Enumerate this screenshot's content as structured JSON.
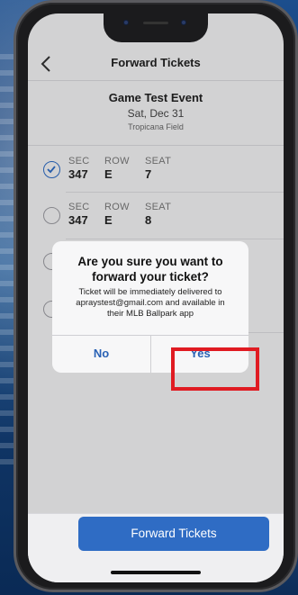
{
  "header": {
    "back_icon": "chevron-left-icon",
    "title": "Forward Tickets"
  },
  "event": {
    "name": "Game Test Event",
    "date": "Sat, Dec 31",
    "venue": "Tropicana Field"
  },
  "labels": {
    "sec": "SEC",
    "row": "ROW",
    "seat": "SEAT"
  },
  "tickets": [
    {
      "sec": "347",
      "row": "E",
      "seat": "7",
      "selected": true
    },
    {
      "sec": "347",
      "row": "E",
      "seat": "8",
      "selected": false
    },
    {
      "sec": "",
      "row": "",
      "seat": "",
      "selected": false
    },
    {
      "sec": "",
      "row": "",
      "seat": "",
      "selected": false
    }
  ],
  "dialog": {
    "title_line1": "Are you sure you want to",
    "title_line2": "forward your ticket?",
    "msg_line1": "Ticket will be immediately delivered to",
    "msg_line2": "apraystest@gmail.com and available in",
    "msg_line3": "their MLB Ballpark app",
    "no_label": "No",
    "yes_label": "Yes"
  },
  "footer": {
    "button_label": "Forward Tickets"
  },
  "colors": {
    "accent": "#2f6cc4",
    "highlight": "#e01b22"
  }
}
